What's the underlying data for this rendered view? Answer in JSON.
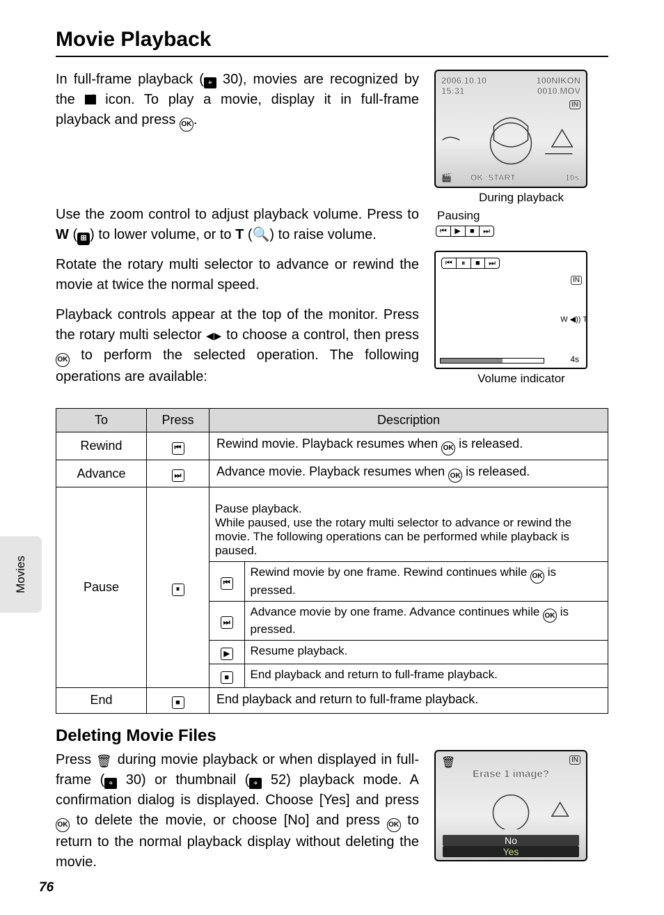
{
  "page": {
    "number": "76",
    "side_tab": "Movies"
  },
  "h1": "Movie Playback",
  "para1": {
    "a": "In full-frame playback (",
    "ref1": " 30), movies are recognized by the ",
    "b": " icon. To play a movie, display it in full-frame playback and press ",
    "c": "."
  },
  "para2": {
    "a": "Use the zoom control to adjust playback volume. Press to ",
    "w": "W",
    "b": " (",
    "c": ") to lower volume, or to ",
    "t": "T",
    "d": " (",
    "e": ") to raise volume."
  },
  "para3": "Rotate the rotary multi selector to advance or rewind the movie at twice the normal speed.",
  "para4": {
    "a": "Playback controls appear at the top of the monitor. Press the rotary multi selector ",
    "b": " to choose a control, then press ",
    "c": " to perform the selected operation. The following operations are available:"
  },
  "screen1": {
    "date": "2006.10.10",
    "time": "15:31",
    "folder": "100NIKON",
    "file": "0010.MOV",
    "in": "IN",
    "ok": "OK :START",
    "dur": "10s",
    "caption": "During playback"
  },
  "screen2": {
    "pausing": "Pausing",
    "in": "IN",
    "time": "4s",
    "vol": "W ◀)) T",
    "caption": "Volume indicator"
  },
  "table": {
    "headers": {
      "to": "To",
      "press": "Press",
      "desc": "Description"
    },
    "rows": [
      {
        "to": "Rewind",
        "press": "⏮",
        "desc_a": "Rewind movie. Playback resumes when ",
        "desc_b": " is released."
      },
      {
        "to": "Advance",
        "press": "⏭",
        "desc_a": "Advance movie. Playback resumes when ",
        "desc_b": " is released."
      },
      {
        "to": "Pause",
        "press": "⏸",
        "intro": "Pause playback.\nWhile paused, use the rotary multi selector to advance or rewind the movie. The following operations can be performed while playback is paused.",
        "sub": [
          {
            "icon": "⏮",
            "text_a": "Rewind movie by one frame. Rewind continues while ",
            "text_b": " is pressed."
          },
          {
            "icon": "⏭",
            "text_a": "Advance movie by one frame. Advance continues while ",
            "text_b": " is pressed."
          },
          {
            "icon": "▶",
            "text": "Resume playback."
          },
          {
            "icon": "■",
            "text": "End playback and return to full-frame playback."
          }
        ]
      },
      {
        "to": "End",
        "press": "■",
        "desc": "End playback and return to full-frame playback."
      }
    ]
  },
  "h2": "Deleting Movie Files",
  "para5": {
    "a": "Press ",
    "b": " during movie playback or when displayed in full-frame (",
    "ref1": " 30) or thumbnail (",
    "ref2": " 52) playback mode. A confirmation dialog is displayed. Choose [Yes] and press ",
    "c": " to delete the movie, or choose [No] and press ",
    "d": " to return to the normal playback display without deleting the movie."
  },
  "screen3": {
    "q": "Erase 1 image?",
    "no": "No",
    "yes": "Yes",
    "in": "IN"
  }
}
